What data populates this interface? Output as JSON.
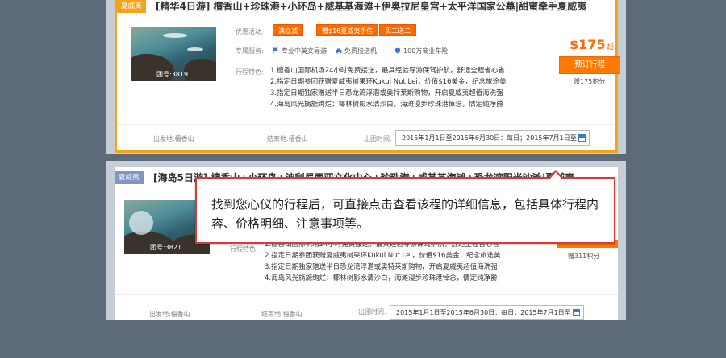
{
  "listings": [
    {
      "tag": "夏威夷",
      "title": "[精华4日游] 檀香山+珍珠港+小环岛+威基基海滩+伊奥拉尼皇宫+太平洋国家公墓|甜蜜牵手夏威夷",
      "photo_id": "团号:3819",
      "offer_label": "优惠活动:",
      "badges": [
        "满立减",
        "赠$16夏威夷手信",
        "买二送二"
      ],
      "service_label": "专属服务:",
      "services": [
        {
          "icon": "flag-icon",
          "text": "专业中英文导游"
        },
        {
          "icon": "car-icon",
          "text": "免费接送机"
        },
        {
          "icon": "shield-icon",
          "text": "100万商业车险"
        }
      ],
      "features_label": "行程特色:",
      "features": [
        "1.檀香山国际机场24小时免费接送，最具经验导游保驾护航，舒适全程省心省",
        "2.指定日期参团获赠夏威夷树果环Kukui Nut Lei，价值$16美金，纪念旅途美",
        "3.指定日期独家赠送半日恐龙湾浮潜或奥特莱斯购物，开启夏威夷超值海洗强",
        "4.海岛风光旖旎绚烂：椰林树影水清沙白，海滩漫步珍珠港悼念，情定纯净爵"
      ],
      "price": "$175",
      "price_suffix": "起",
      "book_label": "预订行程",
      "points": "赠175积分",
      "depart": "出发地:檀香山",
      "end": "结束地:檀香山",
      "date_label": "出团时间:",
      "dates": "2015年1月1日至2015年6月30日：每日；2015年7月1日至"
    },
    {
      "tag": "夏威夷",
      "title": "[海岛5日游] 檀香山+小环岛+波利尼西亚文化中心+珍珠港+威基基海滩+恐龙湾阳光沙滩|夏威夷",
      "photo_id": "团号:3821",
      "features_label": "行程特色:",
      "features": [
        "1.檀香山国际机场24小时免费接送，最具经验导游保驾护航，舒适全程省心省",
        "2.指定日期参团获赠夏威夷树果环Kukui Nut Lei，价值$16美金，纪念旅途美",
        "3.指定日期独家赠送半日恐龙湾浮潜或奥特莱斯购物，开启夏威夷超值海洗强",
        "4.海岛风光旖旎绚烂：椰林树影水清沙白，海滩漫步珍珠港悼念，情定纯净爵"
      ],
      "points": "赠311积分",
      "depart": "出发地:檀香山",
      "end": "结束地:檀香山",
      "date_label": "出团时间:",
      "dates": "2015年1月1日至2015年6月30日：每日；2015年7月1日至"
    }
  ],
  "tooltip": {
    "text": "找到您心仪的行程后，可直接点击查看该程的详细信息，包括具体行程内容、价格明细、注意事项等。"
  },
  "colors": {
    "accent": "#f6a31c",
    "price": "#ff6a00",
    "tooltip_border": "#d63a3a",
    "backdrop": "#5d6a7a"
  }
}
